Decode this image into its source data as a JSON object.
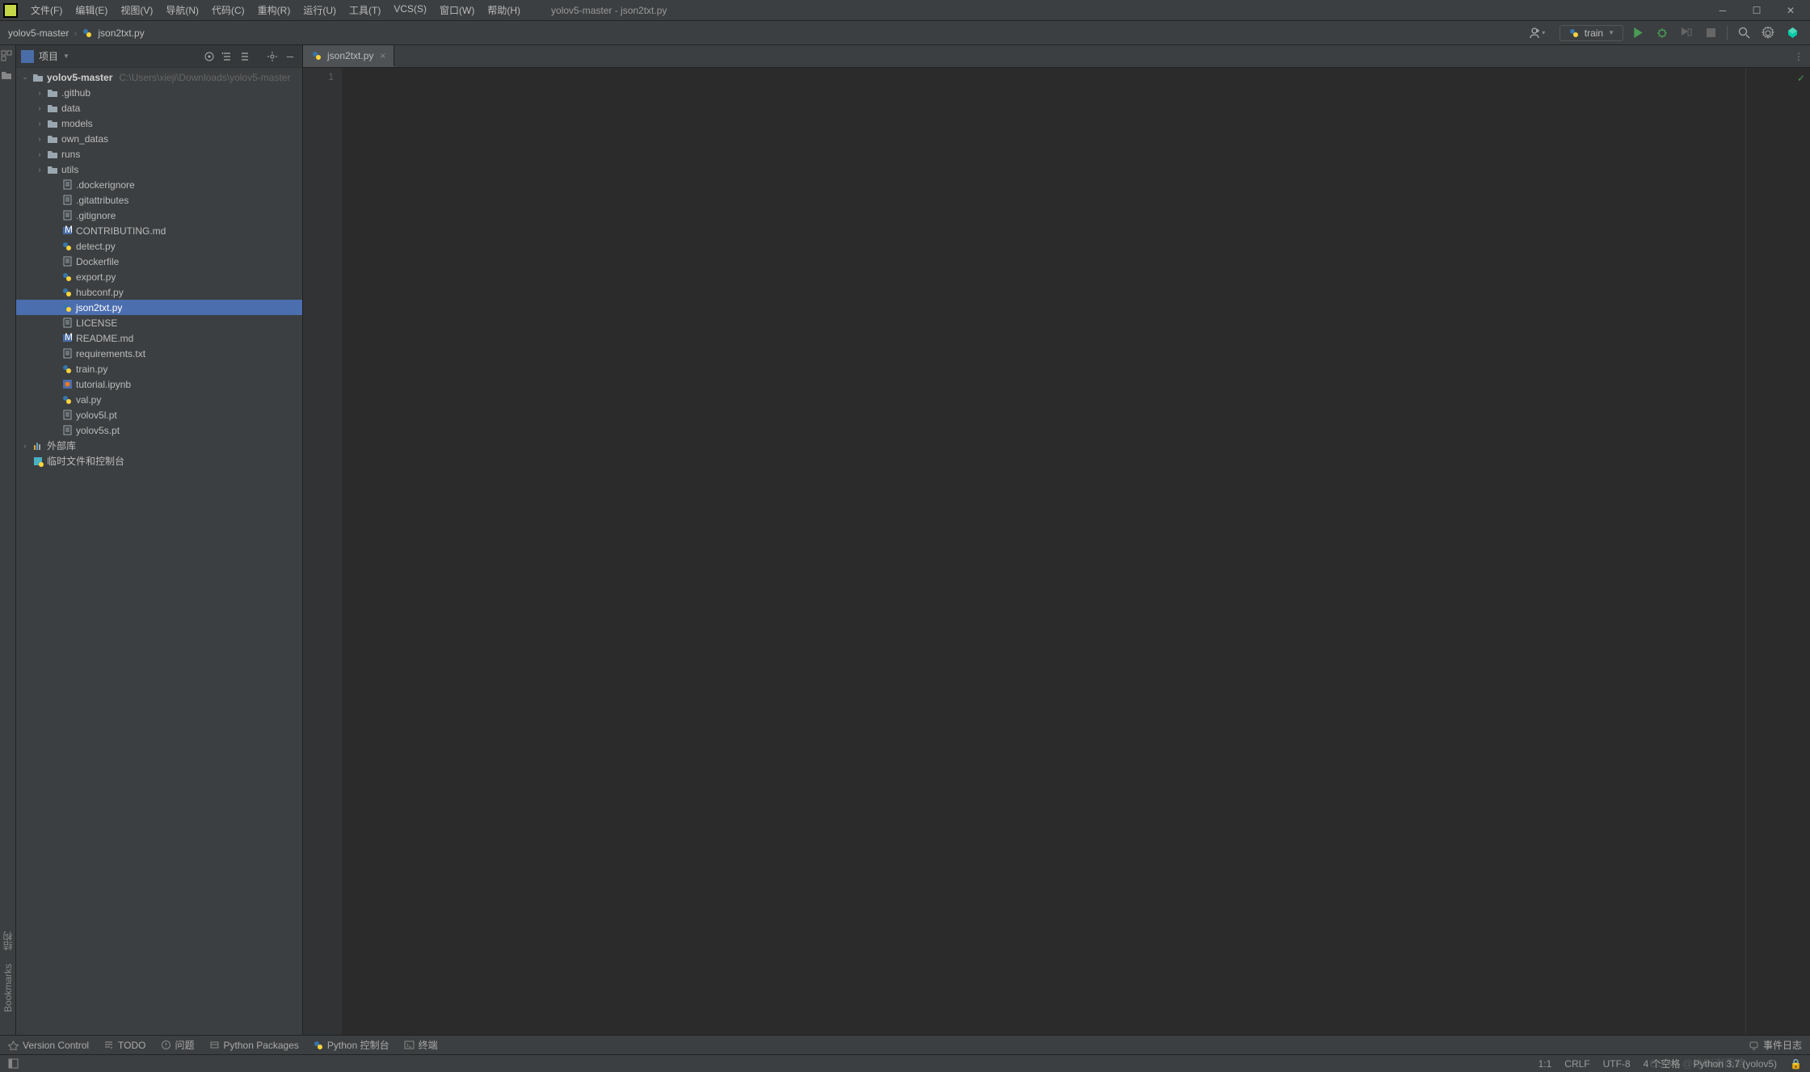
{
  "window": {
    "title": "yolov5-master - json2txt.py",
    "menu": [
      "文件(F)",
      "编辑(E)",
      "视图(V)",
      "导航(N)",
      "代码(C)",
      "重构(R)",
      "运行(U)",
      "工具(T)",
      "VCS(S)",
      "窗口(W)",
      "帮助(H)"
    ]
  },
  "breadcrumb": {
    "root": "yolov5-master",
    "file": "json2txt.py"
  },
  "run_config": {
    "name": "train"
  },
  "sidebar": {
    "title": "项目",
    "root": {
      "name": "yolov5-master",
      "path": "C:\\Users\\xieji\\Downloads\\yolov5-master"
    },
    "folders": [
      ".github",
      "data",
      "models",
      "own_datas",
      "runs",
      "utils"
    ],
    "files": [
      {
        "name": ".dockerignore",
        "type": "file"
      },
      {
        "name": ".gitattributes",
        "type": "file"
      },
      {
        "name": ".gitignore",
        "type": "file"
      },
      {
        "name": "CONTRIBUTING.md",
        "type": "md"
      },
      {
        "name": "detect.py",
        "type": "py"
      },
      {
        "name": "Dockerfile",
        "type": "file"
      },
      {
        "name": "export.py",
        "type": "py"
      },
      {
        "name": "hubconf.py",
        "type": "py"
      },
      {
        "name": "json2txt.py",
        "type": "py",
        "selected": true
      },
      {
        "name": "LICENSE",
        "type": "file"
      },
      {
        "name": "README.md",
        "type": "md"
      },
      {
        "name": "requirements.txt",
        "type": "file"
      },
      {
        "name": "train.py",
        "type": "py"
      },
      {
        "name": "tutorial.ipynb",
        "type": "ipynb"
      },
      {
        "name": "val.py",
        "type": "py"
      },
      {
        "name": "yolov5l.pt",
        "type": "file"
      },
      {
        "name": "yolov5s.pt",
        "type": "file"
      }
    ],
    "external": "外部库",
    "temp": "临时文件和控制台"
  },
  "tab": {
    "name": "json2txt.py"
  },
  "editor": {
    "line": "1"
  },
  "bottom": {
    "items": [
      "Version Control",
      "TODO",
      "问题",
      "Python Packages",
      "Python 控制台",
      "终端"
    ],
    "event_log": "事件日志"
  },
  "left_gutter": {
    "structure": "结构",
    "bookmarks": "Bookmarks"
  },
  "status": {
    "pos": "1:1",
    "lineend": "CRLF",
    "encoding": "UTF-8",
    "indent": "4 个空格",
    "interpreter": "Python 3.7 (yolov5)"
  },
  "watermark": "CSDN @她叫谢雨路"
}
